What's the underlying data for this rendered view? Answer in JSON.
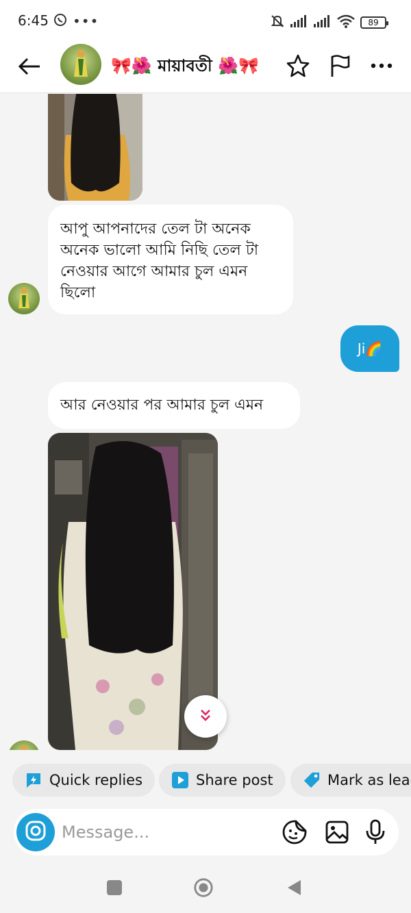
{
  "status_bar": {
    "time": "6:45",
    "battery": "89",
    "icons": [
      "whatsapp-icon",
      "more-icon",
      "mute-icon",
      "signal-icon",
      "signal-icon",
      "wifi-icon",
      "battery-icon"
    ]
  },
  "header": {
    "contact_name": "🎀🌺 মায়াবতী 🌺🎀",
    "icons": [
      "back-arrow-icon",
      "star-icon",
      "flag-icon",
      "more-options-icon"
    ]
  },
  "messages": [
    {
      "type": "image",
      "direction": "incoming"
    },
    {
      "type": "text",
      "direction": "incoming",
      "lines": [
        "আপু আপনাদের তেল টা অনেক",
        "অনেক ভালো আমি নিছি তেল টা",
        "নেওয়ার আগে আমার চুল এমন",
        "ছিলো"
      ]
    },
    {
      "type": "text",
      "direction": "outgoing",
      "text": "Ji🌈"
    },
    {
      "type": "text",
      "direction": "incoming",
      "text": "আর নেওয়ার পর আমার চুল এমন"
    },
    {
      "type": "image",
      "direction": "incoming"
    }
  ],
  "quick_actions": [
    {
      "label": "Quick replies",
      "icon": "lightning-chat-icon"
    },
    {
      "label": "Share post",
      "icon": "play-post-icon"
    },
    {
      "label": "Mark as lead",
      "icon": "tag-icon"
    }
  ],
  "composer": {
    "placeholder": "Message...",
    "icons": [
      "camera-icon",
      "sticker-icon",
      "gallery-icon",
      "microphone-icon"
    ]
  },
  "colors": {
    "accent": "#1e9fd7",
    "incoming_bubble": "#ffffff",
    "background": "#f4f4f4",
    "chip_background": "#e8e8e8",
    "scroll_chevron": "#e0245e"
  }
}
